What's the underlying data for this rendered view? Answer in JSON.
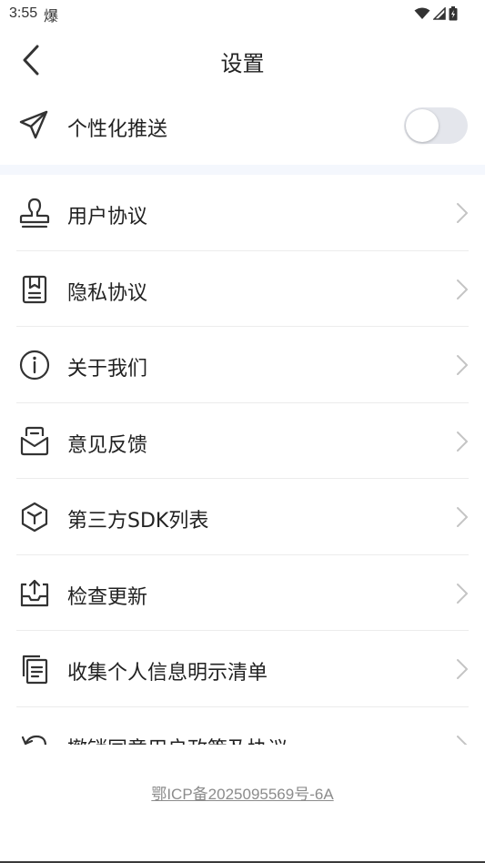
{
  "status_bar": {
    "time": "3:55",
    "app_glyph": "爆",
    "icons": [
      "wifi-icon",
      "signal-icon",
      "battery-icon"
    ]
  },
  "header": {
    "title": "设置",
    "back_icon": "back-arrow-icon"
  },
  "push": {
    "label": "个性化推送",
    "icon": "paper-plane-icon",
    "enabled": false
  },
  "menu": {
    "items": [
      {
        "label": "用户协议",
        "icon": "stamp-icon"
      },
      {
        "label": "隐私协议",
        "icon": "document-icon"
      },
      {
        "label": "关于我们",
        "icon": "info-icon"
      },
      {
        "label": "意见反馈",
        "icon": "feedback-icon"
      },
      {
        "label": "第三方SDK列表",
        "icon": "cube-icon"
      },
      {
        "label": "检查更新",
        "icon": "upload-tray-icon"
      },
      {
        "label": "收集个人信息明示清单",
        "icon": "files-icon"
      },
      {
        "label": "撤销同意用户政策及协议",
        "icon": "undo-icon"
      }
    ]
  },
  "footer": {
    "icp": "鄂ICP备2025095569号-6A"
  },
  "colors": {
    "text": "#222222",
    "section_bg": "#f4f7fd",
    "toggle_off": "#e4e6ec",
    "chevron": "#c4c4c4",
    "footer_text": "#8c8c8c"
  }
}
